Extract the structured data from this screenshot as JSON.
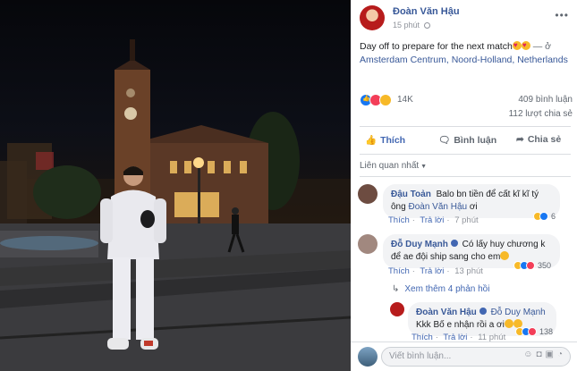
{
  "post": {
    "author": "Đoàn Văn Hậu",
    "time": "15 phút",
    "text": "Day off to prepare for the next match",
    "location_prefix": "— ở",
    "location": "Amsterdam Centrum, Noord-Holland, Netherlands",
    "reaction_count": "14K",
    "comment_count": "409 bình luận",
    "share_count": "112 lượt chia sẻ"
  },
  "actions": {
    "like": "Thích",
    "comment": "Bình luận",
    "share": "Chia sẻ"
  },
  "relevance_label": "Liên quan nhất",
  "comments": [
    {
      "author": "Đậu Toản",
      "text": "Balo bn tiền để cất kĩ kĩ tý ông",
      "tag": "Đoàn Văn Hậu",
      "tag_suffix": "ơi",
      "like": "Thích",
      "reply": "Trả lời",
      "time": "7 phút",
      "reactions": "6"
    },
    {
      "author": "Đỗ Duy Mạnh",
      "text": "Có lấy huy chương k để ae đội ship sang cho em",
      "like": "Thích",
      "reply": "Trả lời",
      "time": "13 phút",
      "reactions": "350"
    }
  ],
  "view_more_replies": "Xem thêm 4 phản hồi",
  "reply": {
    "author": "Đoàn Văn Hậu",
    "tag": "Đỗ Duy Mạnh",
    "text_a": "Kkk",
    "text_b": "Bố e nhận rồi a ơi",
    "like": "Thích",
    "reply": "Trả lời",
    "time": "11 phút",
    "reactions": "138"
  },
  "composer": {
    "placeholder": "Viết bình luận..."
  },
  "colors": {
    "link": "#385898",
    "action_blue": "#4267b2",
    "muted": "#90949c"
  }
}
